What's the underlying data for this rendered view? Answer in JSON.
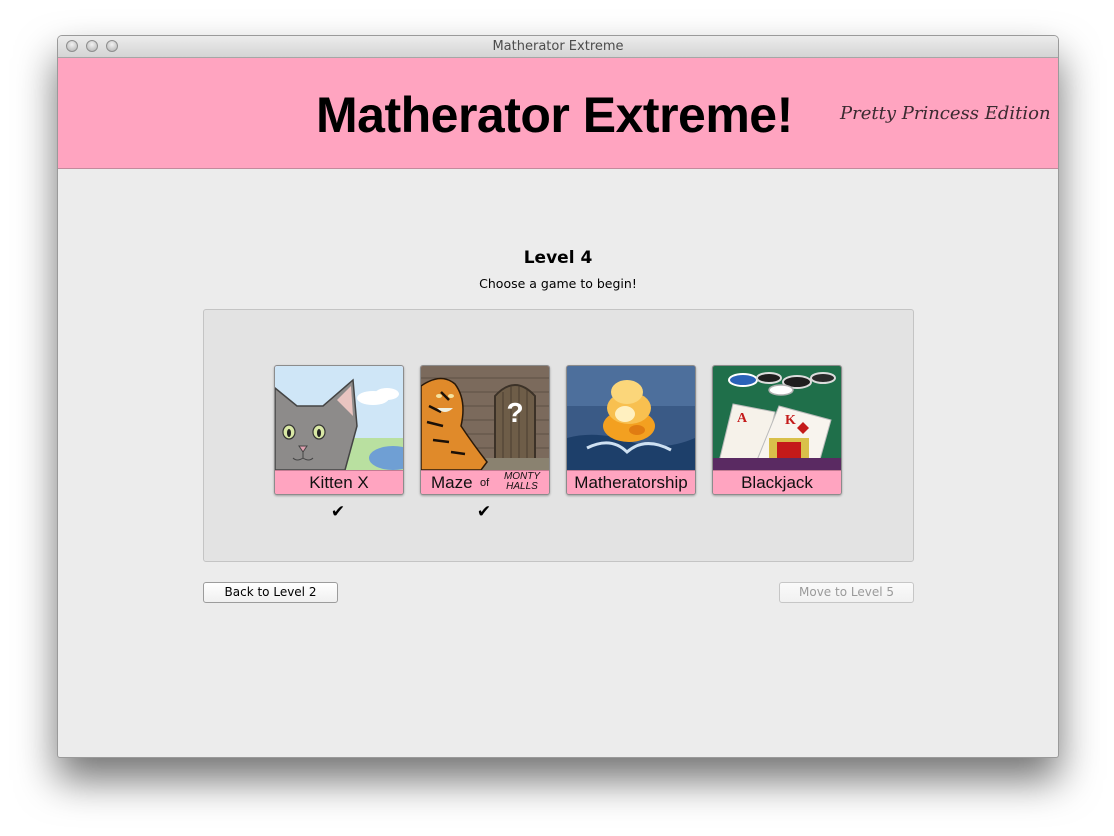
{
  "window": {
    "title": "Matherator Extreme"
  },
  "banner": {
    "title": "Matherator Extreme!",
    "subtitle": "Pretty Princess Edition",
    "background": "#ffa4c0"
  },
  "level": {
    "title": "Level 4",
    "instruction": "Choose a game to begin!"
  },
  "games": [
    {
      "label": "Kitten X",
      "completed": true,
      "check": "✔",
      "icon": "kitten-image"
    },
    {
      "label_main": "Maze",
      "label_of": "of",
      "label_monty": "MONTY",
      "label_halls": "HALLS",
      "completed": true,
      "check": "✔",
      "icon": "tiger-door-image"
    },
    {
      "label": "Matheratorship",
      "completed": false,
      "icon": "explosion-water-image"
    },
    {
      "label": "Blackjack",
      "completed": false,
      "icon": "cards-chips-image"
    }
  ],
  "buttons": {
    "back": "Back to Level 2",
    "next": "Move to Level 5",
    "next_enabled": false
  }
}
